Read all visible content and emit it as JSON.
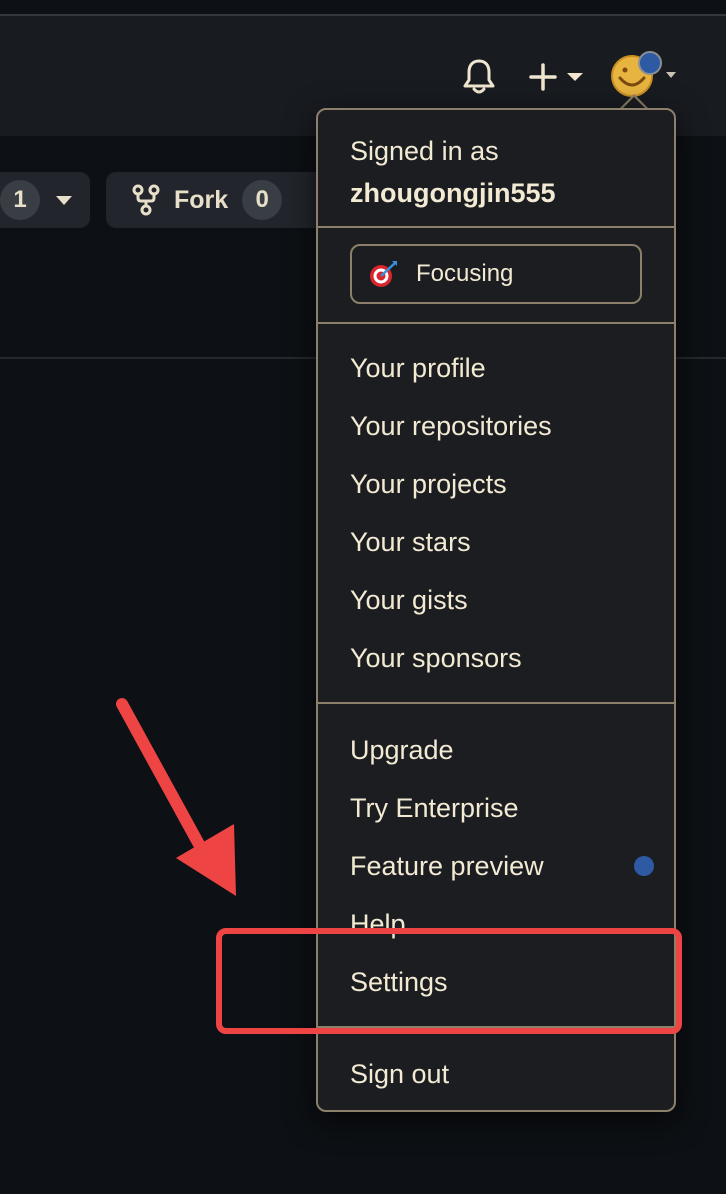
{
  "header": {
    "icons": [
      "bell-icon",
      "plus-icon",
      "chevron-down-icon",
      "avatar"
    ]
  },
  "repo_actions": {
    "watch_count": "1",
    "fork_label": "Fork",
    "fork_count": "0"
  },
  "menu": {
    "signed_in_label": "Signed in as",
    "username": "zhougongjin555",
    "status": {
      "emoji_icon": "target-icon",
      "label": "Focusing"
    },
    "section1": [
      "Your profile",
      "Your repositories",
      "Your projects",
      "Your stars",
      "Your gists",
      "Your sponsors"
    ],
    "section2": [
      "Upgrade",
      "Try Enterprise",
      "Feature preview",
      "Help",
      "Settings"
    ],
    "sign_out": "Sign out"
  },
  "annotation": {
    "highlight_color": "#ef4444",
    "highlighted_item": "Settings"
  },
  "colors": {
    "background": "#0d1014",
    "menu_border": "#8c806a",
    "text": "#f3ead4",
    "feature_dot": "#2e5aa3"
  }
}
